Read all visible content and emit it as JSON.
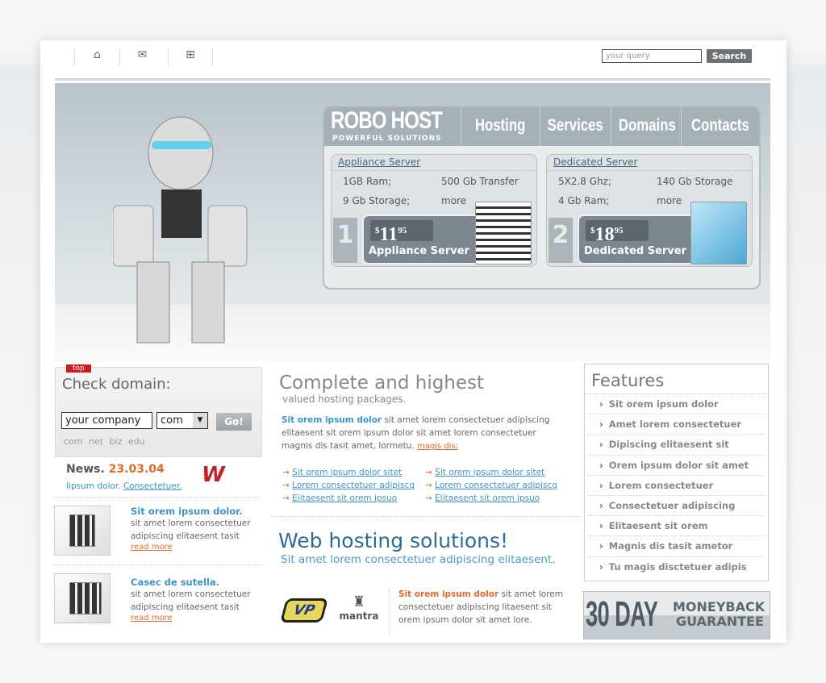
{
  "toolbar": {
    "icons": [
      "home-icon",
      "mail-icon",
      "sitemap-icon"
    ],
    "search_placeholder": "your query",
    "search_label": "Search"
  },
  "brand": {
    "name": "ROBO HOST",
    "tagline": "POWERFUL SOLUTIONS"
  },
  "nav": [
    "Hosting",
    "Services",
    "Domains",
    "Contacts"
  ],
  "plans": [
    {
      "title": "Appliance Server",
      "specs": [
        "1GB Ram;",
        "500 Gb Transfer",
        "9 Gb Storage;",
        "more"
      ],
      "number": "1",
      "currency": "$",
      "price": "11",
      "cents": "95",
      "name": "Appliance Server"
    },
    {
      "title": "Dedicated Server",
      "specs": [
        "5X2.8 Ghz;",
        "140 Gb Storage",
        "4 Gb Ram;",
        "more"
      ],
      "number": "2",
      "currency": "$",
      "price": "18",
      "cents": "95",
      "name": "Dedicated Server"
    }
  ],
  "domain": {
    "badge": "top",
    "title": "Check domain:",
    "input_value": "your company",
    "tld_selected": "com",
    "go_label": "Go!",
    "tlds": [
      "com",
      "net",
      "biz",
      "edu"
    ]
  },
  "news": {
    "label": "News.",
    "date": "23.03.04",
    "text": "Iipsum dolor.",
    "link": "Consectetuer.",
    "items": [
      {
        "title": "Sit orem ipsum dolor.",
        "body": "sit amet lorem consectetuer adipiscing elitaesent tasit",
        "more": "read more"
      },
      {
        "title": "Casec de sutella.",
        "body": "sit amet lorem consectetuer adipiscing elitaesent tasit",
        "more": "read more"
      }
    ]
  },
  "main": {
    "title": "Complete and highest",
    "subtitle": "valued hosting packages.",
    "lead_bold": "Sit orem ipsum dolor",
    "lead": " sit amet lorem consectetuer adipiscing elitaesent sit orem ipsum dolor sit amet lorem consectetuer magnis dis tasit amet, lormetu.",
    "lead_link": "magis dis:",
    "links_left": [
      "Sit orem ipsum dolor sitet",
      "Lorem consectetuer adipiscq",
      "Elitaesent sit orem ipsuo"
    ],
    "links_right": [
      "Sit orem ipsum dolor sitet",
      "Lorem consectetuer adipiscq",
      "Elitaesent sit orem ipsuo"
    ],
    "title2": "Web hosting solutions!",
    "subtitle2": "Sit amet lorem consectetuer adipiscing elitaesent.",
    "partner_bold": "Sit orem ipsum dolor",
    "partner_text": " sit amet lorem consectetuer adipiscing litaesent sit orem ipsum dolor sit amet lore.",
    "logos": [
      "VP",
      "mantra"
    ]
  },
  "features": {
    "title": "Features",
    "items": [
      "Sit orem ipsum dolor",
      "Amet lorem consectetuer",
      "Dipiscing elitaesent sit",
      "Orem ipsum dolor sit amet",
      "Lorem consectetuer",
      "Consectetuer adipiscing",
      "Elitaesent sit orem",
      "Magnis dis tasit ametor",
      "Tu magis disctetuer adipis"
    ]
  },
  "guarantee": {
    "big": "30 DAY",
    "line1": "MONEYBACK",
    "line2": "GUARANTEE"
  },
  "colors": {
    "accent_blue": "#3c94c8",
    "accent_orange": "#e06a2a",
    "nav_gray": "#a6b1b7"
  }
}
